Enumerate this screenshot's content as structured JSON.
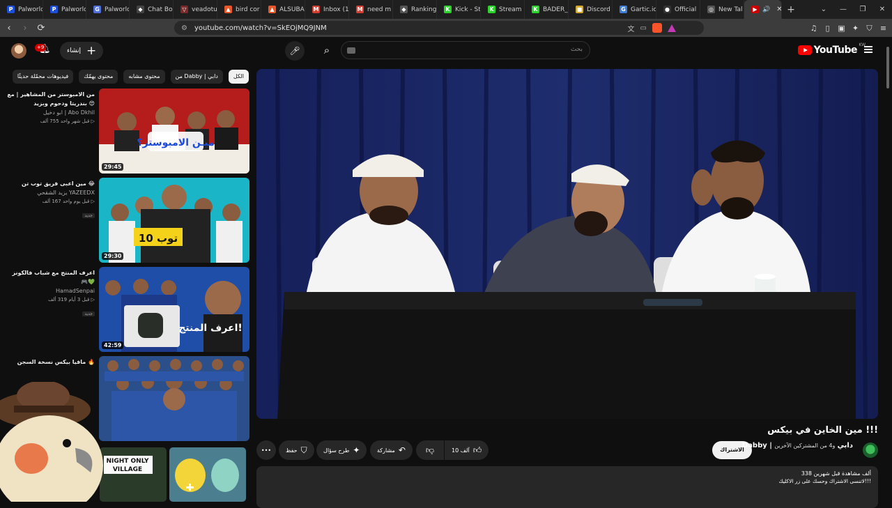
{
  "browser": {
    "tabs": [
      {
        "label": "Palworld",
        "fav": "P",
        "color": "#1d4ed8"
      },
      {
        "label": "Palworld",
        "fav": "P",
        "color": "#1d4ed8"
      },
      {
        "label": "Palworld",
        "fav": "G",
        "color": "#4f6fd9"
      },
      {
        "label": "Chat Bo",
        "fav": "◆",
        "color": "#444444"
      },
      {
        "label": "veadotu",
        "fav": "▽",
        "color": "#7a2a2a"
      },
      {
        "label": "bird cor",
        "fav": "▲",
        "color": "#e8572a"
      },
      {
        "label": "ALSUBA",
        "fav": "▲",
        "color": "#e8572a"
      },
      {
        "label": "Inbox (1",
        "fav": "M",
        "color": "#d23f31"
      },
      {
        "label": "need m",
        "fav": "M",
        "color": "#d23f31"
      },
      {
        "label": "Ranking",
        "fav": "◆",
        "color": "#555555"
      },
      {
        "label": "Kick - St",
        "fav": "K",
        "color": "#2bd42b"
      },
      {
        "label": "Stream",
        "fav": "K",
        "color": "#2bd42b"
      },
      {
        "label": "BADER_",
        "fav": "K",
        "color": "#2bd42b"
      },
      {
        "label": "Discord",
        "fav": "■",
        "color": "#d4a72b"
      },
      {
        "label": "Gartic.io",
        "fav": "G",
        "color": "#3d7bd9"
      },
      {
        "label": "Official",
        "fav": "●",
        "color": "#333333"
      },
      {
        "label": "New Tal",
        "fav": "◎",
        "color": "#555555"
      }
    ],
    "active_tab": {
      "fav": "▶",
      "sound": "🔊",
      "close": "✕"
    },
    "new_tab": "+",
    "window_controls": [
      "⌄",
      "—",
      "❐",
      "✕"
    ],
    "url": "youtube.com/watch?v=SkEOjMQ9JNM"
  },
  "header": {
    "logo_text": "YouTube",
    "region": "KW",
    "search_placeholder": "بحث",
    "create_label": "إنشاء",
    "notifications_count": "+9"
  },
  "chips": [
    "الكل",
    "من Dabby | دابي",
    "محتوى مشابه",
    "محتوى يهمّك",
    "فيديوهات محمّلة حديثًا"
  ],
  "recommendations": [
    {
      "title": "من الامبوستر من المشاهير | مع بندريتا ودحوم وبزيد 😍",
      "channel": "ابو دخيل | Abo Dkhil",
      "views": "755 ألف",
      "age": "قبل شهر واحد",
      "duration": "29:45",
      "badge": ""
    },
    {
      "title": "مين اعبى فريق توب تن 😂",
      "channel": "يزيد الشقحي YAZEEDX",
      "views": "167 ألف",
      "age": "قبل يوم واحد",
      "duration": "29:30",
      "badge": "جديد"
    },
    {
      "title": "اعرف المنتج مع شباب فالكونز 🎮💚",
      "channel": "HamadSenpai",
      "views": "319 ألف",
      "age": "قبل 3 أيام",
      "duration": "42:59",
      "badge": "جديد"
    },
    {
      "title": "مافيا بيكس نسخة السجن 🔥",
      "channel": "",
      "views": "",
      "age": "",
      "duration": "",
      "badge": ""
    }
  ],
  "thumb_text": {
    "t1": "ميـن الامبوستر؟",
    "t2": "توب 10",
    "t3": "اعرف المنتج!",
    "mini1": "NIGHT ONLY VILLAGE"
  },
  "video": {
    "title": "مين الخاين في بيكس !!!",
    "channel": "Dabby | دابي",
    "subscribers": "و4 من المشتركين الآخرين",
    "subscribe_label": "الاشتراك",
    "likes": "10 آلف",
    "share_label": "مشاركة",
    "ask_label": "طرح سؤال",
    "save_label": "حفظ",
    "more_label": "•••",
    "stats": "338 ألف مشاهدة  قبل شهرين",
    "description": "لاتنسى الاشتراك وحسك على زر الاكليك!!!"
  },
  "colors": {
    "accent": "#ff0000",
    "bg": "#0f0f0f",
    "chip": "#272727"
  }
}
